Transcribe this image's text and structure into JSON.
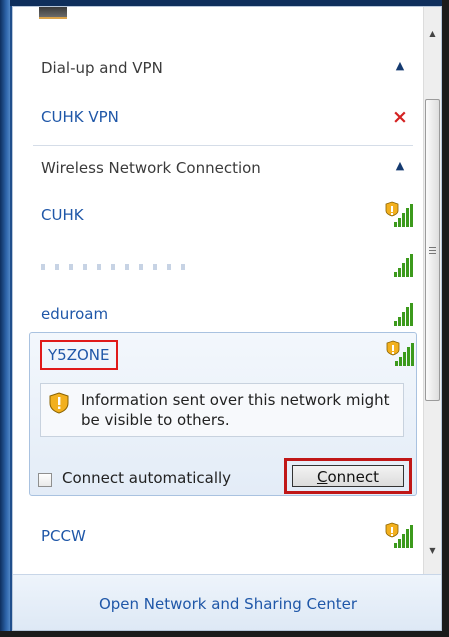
{
  "sections": {
    "dialup": {
      "label": "Dial-up and VPN",
      "chevron": "▲"
    },
    "wireless": {
      "label": "Wireless Network Connection",
      "chevron": "▲"
    }
  },
  "vpn": {
    "name": "CUHK VPN",
    "status_icon": "×"
  },
  "networks": [
    {
      "name": "CUHK",
      "secured": false
    },
    {
      "name": "",
      "secured": true
    },
    {
      "name": "eduroam",
      "secured": true
    },
    {
      "name": "Y5ZONE",
      "secured": false
    },
    {
      "name": "PCCW",
      "secured": false
    }
  ],
  "selected_network": {
    "name": "Y5ZONE",
    "info": "Information sent over this network might be visible to others.",
    "connect_auto_label": "Connect automatically",
    "connect_auto_checked": false,
    "connect_button": {
      "underlined": "C",
      "rest": "onnect"
    }
  },
  "footer": {
    "link": "Open Network and Sharing Center"
  },
  "scrollbar": {
    "up": "▲",
    "down": "▼"
  },
  "colors": {
    "link": "#1f57a8",
    "highlight": "#e01a1a",
    "warning_shield": "#f2b01e"
  }
}
